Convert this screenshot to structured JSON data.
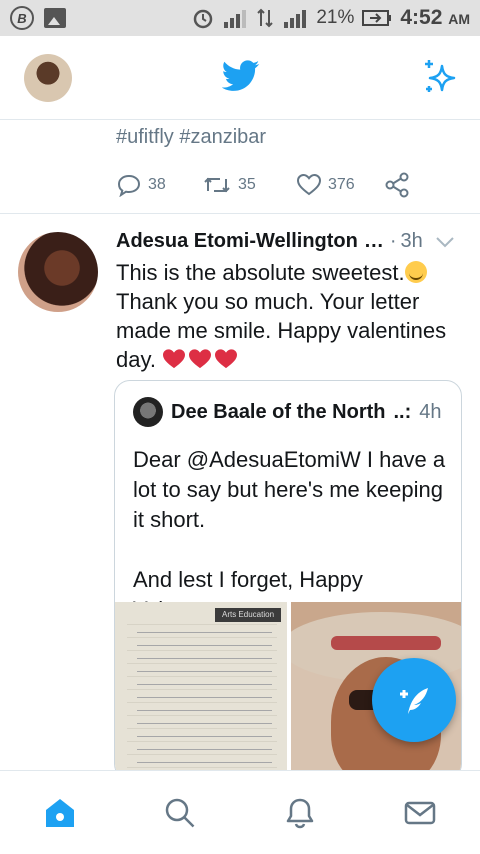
{
  "status_bar": {
    "battery": "21%",
    "time": "4:52",
    "ampm": "AM",
    "icons": [
      "b-circle-icon",
      "image-icon",
      "alarm-icon",
      "signal-icon",
      "data-arrows-icon",
      "signal-h-icon",
      "battery-icon"
    ]
  },
  "app_bar": {
    "avatar": "profile-avatar",
    "logo": "twitter-bird-icon",
    "right_action": "sparkle-icon"
  },
  "previous_tweet": {
    "hashtags": "#ufitfly #zanzibar",
    "replies": "38",
    "retweets": "35",
    "likes": "376"
  },
  "tweet": {
    "author": "Adesua Etomi-Wellington",
    "name_ellipsis": "…",
    "separator": "·",
    "time": "3h",
    "text_before_emoji": "This is the absolute sweetest.",
    "text_after": "Thank you so much. Your letter made me smile. Happy valentines day.",
    "quote": {
      "author": "Dee Baale of the North",
      "name_ellipsis": "..:",
      "time": "4h",
      "text": "Dear @AdesuaEtomiW I have a lot to say but here's me keeping it short.\n\nAnd lest I forget, Happy Valent…",
      "image1_banner": "Arts Education"
    }
  },
  "bottom_nav": {
    "items": [
      "home",
      "search",
      "notifications",
      "messages"
    ],
    "active": "home"
  },
  "colors": {
    "brand": "#1DA1F2",
    "muted": "#657786",
    "text": "#14171A",
    "heart": "#DD2E44"
  }
}
